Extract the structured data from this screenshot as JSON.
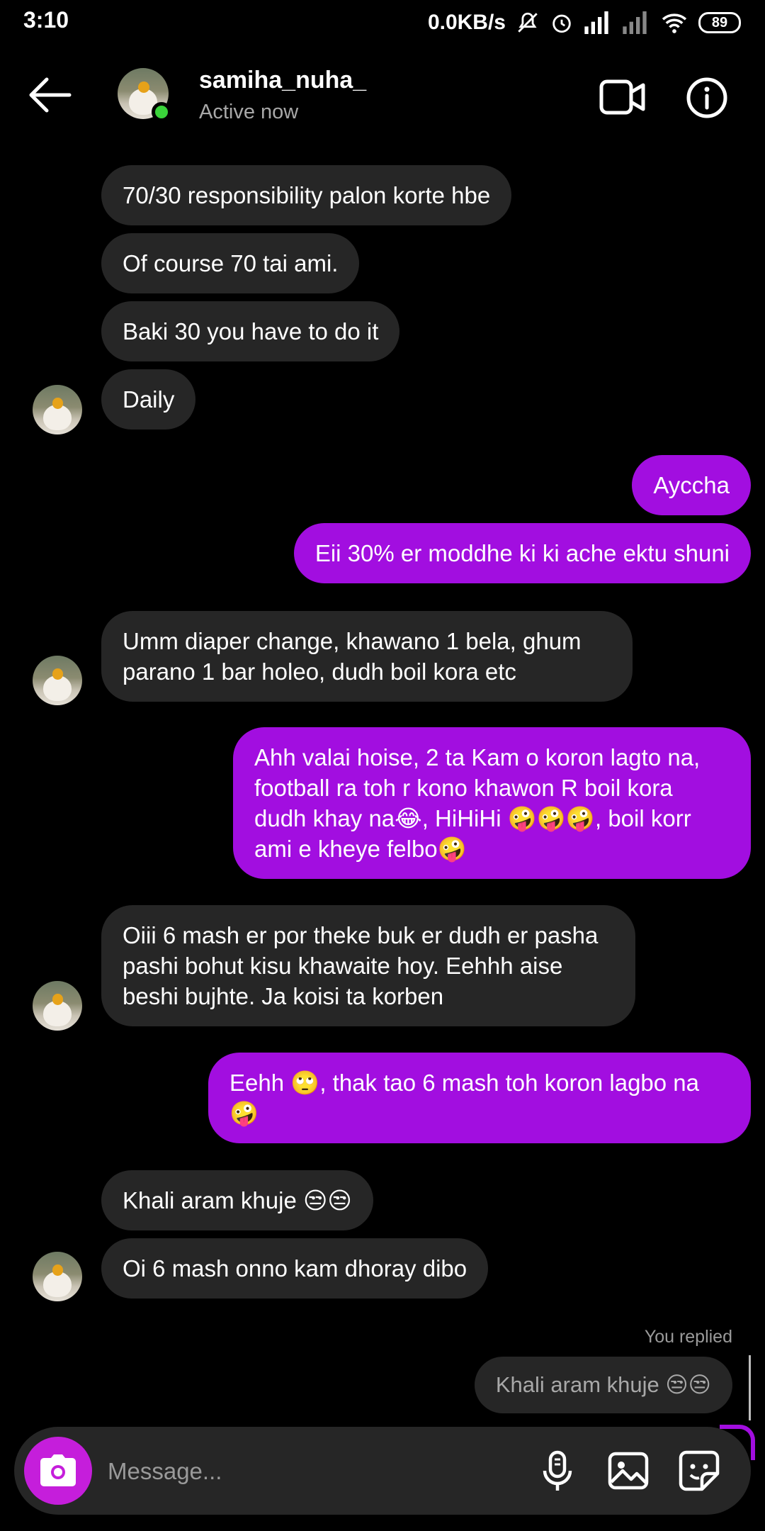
{
  "status_bar": {
    "time": "3:10",
    "speed": "0.0KB/s",
    "battery": "89"
  },
  "header": {
    "username": "samiha_nuha_",
    "status": "Active now"
  },
  "messages": [
    {
      "text": "70/30 responsibility palon korte hbe"
    },
    {
      "text": "Of course 70 tai ami."
    },
    {
      "text": "Baki 30  you have to do it"
    },
    {
      "text": "Daily"
    },
    {
      "text": "Ayccha"
    },
    {
      "text": "Eii 30% er moddhe ki ki ache ektu shuni"
    },
    {
      "text": "Umm diaper change, khawano 1 bela, ghum parano 1 bar holeo, dudh boil kora etc"
    },
    {
      "text": "Ahh valai hoise, 2 ta Kam o koron lagto na, football ra toh r kono khawon R boil kora dudh khay na😂, HiHiHi 🤪🤪🤪, boil korr ami e kheye felbo🤪"
    },
    {
      "text": "Oiii 6 mash er por theke buk er dudh er pasha pashi bohut kisu khawaite hoy. Eehhh aise beshi bujhte. Ja koisi ta korben"
    },
    {
      "text": "Eehh 🙄, thak tao 6 mash toh koron lagbo na 🤪"
    },
    {
      "text": "Khali aram khuje 😒😒"
    },
    {
      "text": "Oi 6 mash onno kam dhoray dibo"
    }
  ],
  "reply": {
    "label": "You replied",
    "quote": "Khali aram khuje 😒😒"
  },
  "composer": {
    "placeholder": "Message..."
  },
  "colors": {
    "sent_bubble": "#a20ee0",
    "received_bubble": "#262626",
    "camera_button": "#c51edb",
    "online": "#3ad33a"
  },
  "icons": [
    "back-arrow-icon",
    "video-call-icon",
    "info-icon",
    "camera-icon",
    "microphone-icon",
    "gallery-icon",
    "sticker-icon"
  ]
}
